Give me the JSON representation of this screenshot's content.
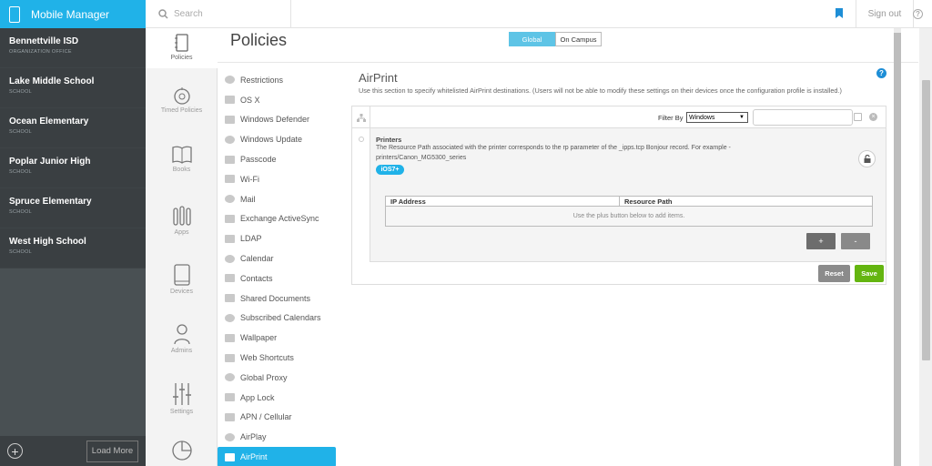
{
  "app": {
    "title": "Mobile Manager"
  },
  "topbar": {
    "search_placeholder": "Search",
    "signout_label": "Sign out",
    "help_label": "?"
  },
  "orgs": [
    {
      "name": "Bennettville ISD",
      "type": "ORGANIZATION OFFICE"
    },
    {
      "name": "Lake Middle School",
      "type": "SCHOOL"
    },
    {
      "name": "Ocean Elementary",
      "type": "SCHOOL"
    },
    {
      "name": "Poplar Junior High",
      "type": "SCHOOL"
    },
    {
      "name": "Spruce Elementary",
      "type": "SCHOOL"
    },
    {
      "name": "West High School",
      "type": "SCHOOL"
    }
  ],
  "org_footer": {
    "add_label": "+",
    "load_more": "Load More"
  },
  "icon_nav": [
    {
      "label": "Policies",
      "icon": "policies-icon",
      "active": true
    },
    {
      "label": "Timed Policies",
      "icon": "timed-policies-icon"
    },
    {
      "label": "Books",
      "icon": "books-icon"
    },
    {
      "label": "Apps",
      "icon": "apps-icon"
    },
    {
      "label": "Devices",
      "icon": "devices-icon"
    },
    {
      "label": "Admins",
      "icon": "admins-icon"
    },
    {
      "label": "Settings",
      "icon": "settings-icon"
    },
    {
      "label": "",
      "icon": "reports-icon"
    }
  ],
  "page": {
    "title": "Policies",
    "scope_options": [
      "Global",
      "On Campus"
    ],
    "scope_selected": "Global"
  },
  "policy_list": [
    "Restrictions",
    "OS X",
    "Windows Defender",
    "Windows Update",
    "Passcode",
    "Wi-Fi",
    "Mail",
    "Exchange ActiveSync",
    "LDAP",
    "Calendar",
    "Contacts",
    "Shared Documents",
    "Subscribed Calendars",
    "Wallpaper",
    "Web Shortcuts",
    "Global Proxy",
    "App Lock",
    "APN / Cellular",
    "AirPlay",
    "AirPrint"
  ],
  "policy_selected": "AirPrint",
  "content": {
    "title": "AirPrint",
    "description": "Use this section to specify whitelisted AirPrint destinations. (Users will not be able to modify these settings on their devices once the configuration profile is installed.)",
    "filter_label": "Filter By",
    "filter_value": "Windows",
    "printers_title": "Printers",
    "printers_desc": "The Resource Path associated with the printer corresponds to the rp parameter of the _ipps.tcp Bonjour record. For example - printers/Canon_MG5300_series",
    "badge": "iOS7+",
    "table_headers": [
      "IP Address",
      "Resource Path"
    ],
    "table_empty": "Use the plus button below to add items.",
    "plus_label": "+",
    "minus_label": "-",
    "reset_label": "Reset",
    "save_label": "Save",
    "help_label": "?"
  },
  "colors": {
    "accent": "#20b2e8",
    "save": "#64b510",
    "sidebar": "#3a3f42"
  }
}
